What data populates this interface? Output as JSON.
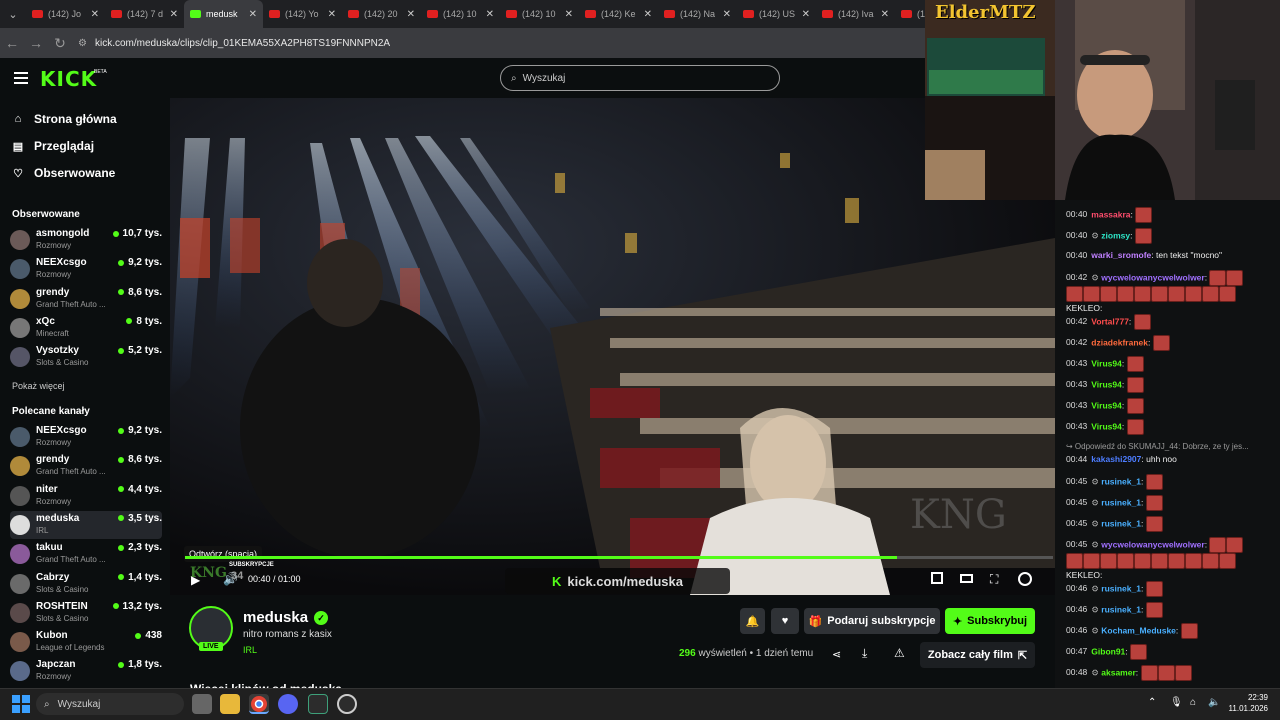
{
  "browser": {
    "tabs": [
      {
        "label": "(142) Jo",
        "active": false
      },
      {
        "label": "(142) 7 d",
        "active": false
      },
      {
        "label": "medusk",
        "active": true
      },
      {
        "label": "(142) Yo",
        "active": false
      },
      {
        "label": "(142) 20",
        "active": false
      },
      {
        "label": "(142) 10",
        "active": false
      },
      {
        "label": "(142) 10",
        "active": false
      },
      {
        "label": "(142) Ke",
        "active": false
      },
      {
        "label": "(142) Na",
        "active": false
      },
      {
        "label": "(142) US",
        "active": false
      },
      {
        "label": "(142) Iva",
        "active": false
      },
      {
        "label": "(142) ",
        "active": false
      }
    ],
    "url": "kick.com/meduska/clips/clip_01KEMA55XA2PH8TS19FNNNPN2A"
  },
  "header": {
    "logo": "KICK",
    "beta": "BETA",
    "search_placeholder": "Wyszukaj"
  },
  "sidebar": {
    "nav": [
      {
        "label": "Strona główna",
        "icon": "home-icon"
      },
      {
        "label": "Przeglądaj",
        "icon": "browse-icon"
      },
      {
        "label": "Obserwowane",
        "icon": "heart-icon"
      }
    ],
    "followed_title": "Obserwowane",
    "followed": [
      {
        "name": "asmongold",
        "category": "Rozmowy",
        "viewers": "10,7 tys."
      },
      {
        "name": "NEEXcsgo",
        "category": "Rozmowy",
        "viewers": "9,2 tys."
      },
      {
        "name": "grendy",
        "category": "Grand Theft Auto ...",
        "viewers": "8,6 tys."
      },
      {
        "name": "xQc",
        "category": "Minecraft",
        "viewers": "8 tys."
      },
      {
        "name": "Vysotzky",
        "category": "Slots & Casino",
        "viewers": "5,2 tys."
      }
    ],
    "show_more": "Pokaż więcej",
    "recommended_title": "Polecane kanały",
    "recommended": [
      {
        "name": "NEEXcsgo",
        "category": "Rozmowy",
        "viewers": "9,2 tys."
      },
      {
        "name": "grendy",
        "category": "Grand Theft Auto ...",
        "viewers": "8,6 tys."
      },
      {
        "name": "niter",
        "category": "Rozmowy",
        "viewers": "4,4 tys."
      },
      {
        "name": "meduska",
        "category": "IRL",
        "viewers": "3,5 tys."
      },
      {
        "name": "takuu",
        "category": "Grand Theft Auto ...",
        "viewers": "2,3 tys."
      },
      {
        "name": "Cabrzy",
        "category": "Slots & Casino",
        "viewers": "1,4 tys."
      },
      {
        "name": "ROSHTEIN",
        "category": "Slots & Casino",
        "viewers": "13,2 tys."
      },
      {
        "name": "Kubon",
        "category": "League of Legends",
        "viewers": "438"
      },
      {
        "name": "Japczan",
        "category": "Rozmowy",
        "viewers": "1,8 tys."
      }
    ]
  },
  "player": {
    "tooltip": "Odtwórz (spacja)",
    "time": "00:40 / 01:00",
    "progress": 0.82,
    "watermark": "kick.com/meduska",
    "overlay_sub": "SUBSKRYPCJE",
    "overlay_count": "34"
  },
  "clip": {
    "channel": "meduska",
    "title": "nitro romans z kasix",
    "category": "IRL",
    "live": "LIVE",
    "gift_label": "Podaruj subskrypcje",
    "subscribe_label": "Subskrybuj",
    "views_count": "296",
    "views_label": "wyświetleń",
    "age": "• 1 dzień temu",
    "full_video_label": "Zobacz cały film",
    "more_clips": "Więcej klipów od meduska"
  },
  "stream_overlay": {
    "brand": "ElderMTZ"
  },
  "chat": [
    {
      "time": "00:40",
      "user": "massakra",
      "color": "#ff4d6d",
      "text": ":",
      "emotes": 1,
      "badge": false
    },
    {
      "time": "00:40",
      "user": "ziomsy",
      "color": "#2ee6c8",
      "text": ":",
      "emotes": 1,
      "badge": true
    },
    {
      "time": "00:40",
      "user": "warki_sromofe",
      "color": "#c080ff",
      "text": ": ten tekst \"mocno\"",
      "emotes": 0,
      "badge": false
    },
    {
      "time": "00:42",
      "user": "wycwelowanycwelwolwer",
      "color": "#a070ff",
      "text": ":",
      "emotes": 2,
      "badge": true,
      "extra": "KEKLEO:",
      "extra_before": 10,
      "extra_after": 0
    },
    {
      "time": "00:42",
      "user": "Vortal777",
      "color": "#ff4d4d",
      "text": ":",
      "emotes": 1,
      "badge": false
    },
    {
      "time": "00:42",
      "user": "dziadekfranek",
      "color": "#ff6a3d",
      "text": ":",
      "emotes": 1,
      "badge": false
    },
    {
      "time": "00:43",
      "user": "Virus94",
      "color": "#53fc18",
      "text": ":",
      "emotes": 1,
      "badge": false
    },
    {
      "time": "00:43",
      "user": "Virus94",
      "color": "#53fc18",
      "text": ":",
      "emotes": 1,
      "badge": false
    },
    {
      "time": "00:43",
      "user": "Virus94",
      "color": "#53fc18",
      "text": ":",
      "emotes": 1,
      "badge": false
    },
    {
      "time": "00:43",
      "user": "Virus94",
      "color": "#53fc18",
      "text": ":",
      "emotes": 1,
      "badge": false
    },
    {
      "time": "",
      "user": "",
      "color": "#9a9a9a",
      "text": "",
      "reply": "↪ Odpowiedź do SKUMAJJ_44: Dobrze, ze ty jes...",
      "emotes": 0,
      "badge": false
    },
    {
      "time": "00:44",
      "user": "kakashi2907",
      "color": "#4d7dff",
      "text": ": uhh noo",
      "emotes": 0,
      "badge": false
    },
    {
      "time": "00:45",
      "user": "rusinek_1",
      "color": "#4ab0ff",
      "text": ":",
      "emotes": 1,
      "badge": true
    },
    {
      "time": "00:45",
      "user": "rusinek_1",
      "color": "#4ab0ff",
      "text": ":",
      "emotes": 1,
      "badge": true
    },
    {
      "time": "00:45",
      "user": "rusinek_1",
      "color": "#4ab0ff",
      "text": ":",
      "emotes": 1,
      "badge": true
    },
    {
      "time": "00:45",
      "user": "wycwelowanycwelwolwer",
      "color": "#a070ff",
      "text": ":",
      "emotes": 2,
      "badge": true,
      "extra": "KEKLEO:",
      "extra_before": 10,
      "extra_after": 0
    },
    {
      "time": "00:46",
      "user": "rusinek_1",
      "color": "#4ab0ff",
      "text": ":",
      "emotes": 1,
      "badge": true
    },
    {
      "time": "00:46",
      "user": "rusinek_1",
      "color": "#4ab0ff",
      "text": ":",
      "emotes": 1,
      "badge": true
    },
    {
      "time": "00:46",
      "user": "Kocham_Meduske",
      "color": "#4ab0ff",
      "text": ":",
      "emotes": 1,
      "badge": true
    },
    {
      "time": "00:47",
      "user": "Gibon91",
      "color": "#53fc18",
      "text": ":",
      "emotes": 1,
      "badge": false
    },
    {
      "time": "00:48",
      "user": "aksamer",
      "color": "#53fc18",
      "text": ":",
      "emotes": 3,
      "badge": true
    }
  ],
  "taskbar": {
    "search": "Wyszukaj",
    "time": "22:39",
    "date": "11.01.2026"
  }
}
